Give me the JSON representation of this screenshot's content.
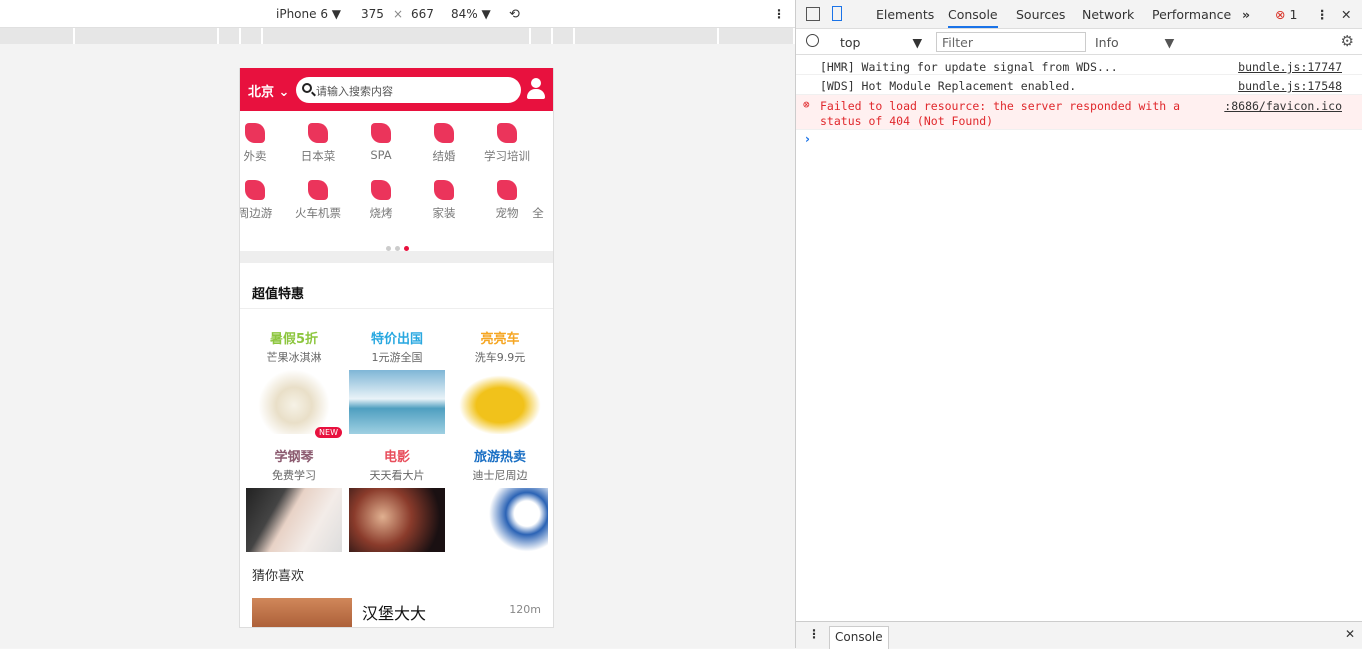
{
  "device": {
    "name": "iPhone 6",
    "width": "375",
    "x": "×",
    "height": "667",
    "zoom": "84%"
  },
  "app": {
    "city": "北京",
    "search_placeholder": "请输入搜索内容",
    "categories_row1": [
      "外卖",
      "日本菜",
      "SPA",
      "结婚",
      "学习培训"
    ],
    "categories_row2": [
      "周边游",
      "火车机票",
      "烧烤",
      "家装",
      "宠物",
      "全"
    ],
    "section_title": "超值特惠",
    "deals": [
      {
        "title": "暑假5折",
        "sub": "芒果冰淇淋",
        "color": "#8dc63f",
        "badge": "NEW"
      },
      {
        "title": "特价出国",
        "sub": "1元游全国",
        "color": "#29a8e0"
      },
      {
        "title": "亮亮车",
        "sub": "洗车9.9元",
        "color": "#f5a623"
      },
      {
        "title": "学钢琴",
        "sub": "免费学习",
        "color": "#8b5a6f"
      },
      {
        "title": "电影",
        "sub": "天天看大片",
        "color": "#e84e5c"
      },
      {
        "title": "旅游热卖",
        "sub": "迪士尼周边",
        "color": "#1a6fc4"
      }
    ],
    "guess_title": "猜你喜欢",
    "item": {
      "name": "汉堡大大",
      "distance": "120m"
    }
  },
  "devtools": {
    "tabs": [
      "Elements",
      "Console",
      "Sources",
      "Network",
      "Performance"
    ],
    "more": "»",
    "error_count": "1",
    "context": "top",
    "filter_placeholder": "Filter",
    "level": "Info",
    "logs": [
      {
        "msg": "[HMR] Waiting for update signal from WDS...",
        "src": "bundle.js:17747",
        "type": "log"
      },
      {
        "msg": "[WDS] Hot Module Replacement enabled.",
        "src": "bundle.js:17548",
        "type": "log"
      },
      {
        "msg": "Failed to load resource: the server responded with a status of 404 (Not Found)",
        "src": ":8686/favicon.ico",
        "type": "error"
      }
    ],
    "prompt": "›",
    "drawer_tab": "Console"
  }
}
